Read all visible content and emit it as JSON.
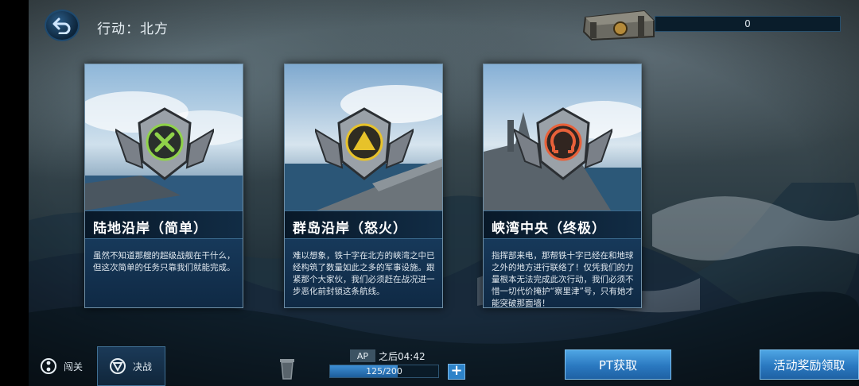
{
  "header": {
    "title": "行动：北方",
    "points_value": "0"
  },
  "cards": [
    {
      "name": "陆地沿岸（简单）",
      "description": "虽然不知道那艘的超级战舰在干什么，但这次简单的任务只靠我们就能完成。",
      "emblem_color": "#8fd24a",
      "emblem_icon": "x-mark-icon"
    },
    {
      "name": "群岛沿岸（怒火）",
      "description": "难以想象，铁十字在北方的峡湾之中已经构筑了数量如此之多的军事设施。跟紧那个大家伙，我们必须赶在战况进一步恶化前封锁这条航线。",
      "emblem_color": "#e7c22a",
      "emblem_icon": "triangle-icon"
    },
    {
      "name": "峡湾中央（终极）",
      "description": "指挥部来电，那帮铁十字已经在和地球之外的地方进行联络了！仅凭我们的力量根本无法完成此次行动，我们必须不惜一切代价掩护“察里津”号，只有她才能突破那面墙！",
      "emblem_color": "#e8613a",
      "emblem_icon": "omega-icon"
    }
  ],
  "bottom": {
    "tab_stage": "闯关",
    "tab_battle": "决战",
    "ap_label": "AP",
    "ap_timer": "之后04:42",
    "ap_value": "125/200",
    "ap_fraction": 0.625,
    "ap_plus": "+",
    "pt_button": "PT获取",
    "reward_button": "活动奖励领取"
  }
}
